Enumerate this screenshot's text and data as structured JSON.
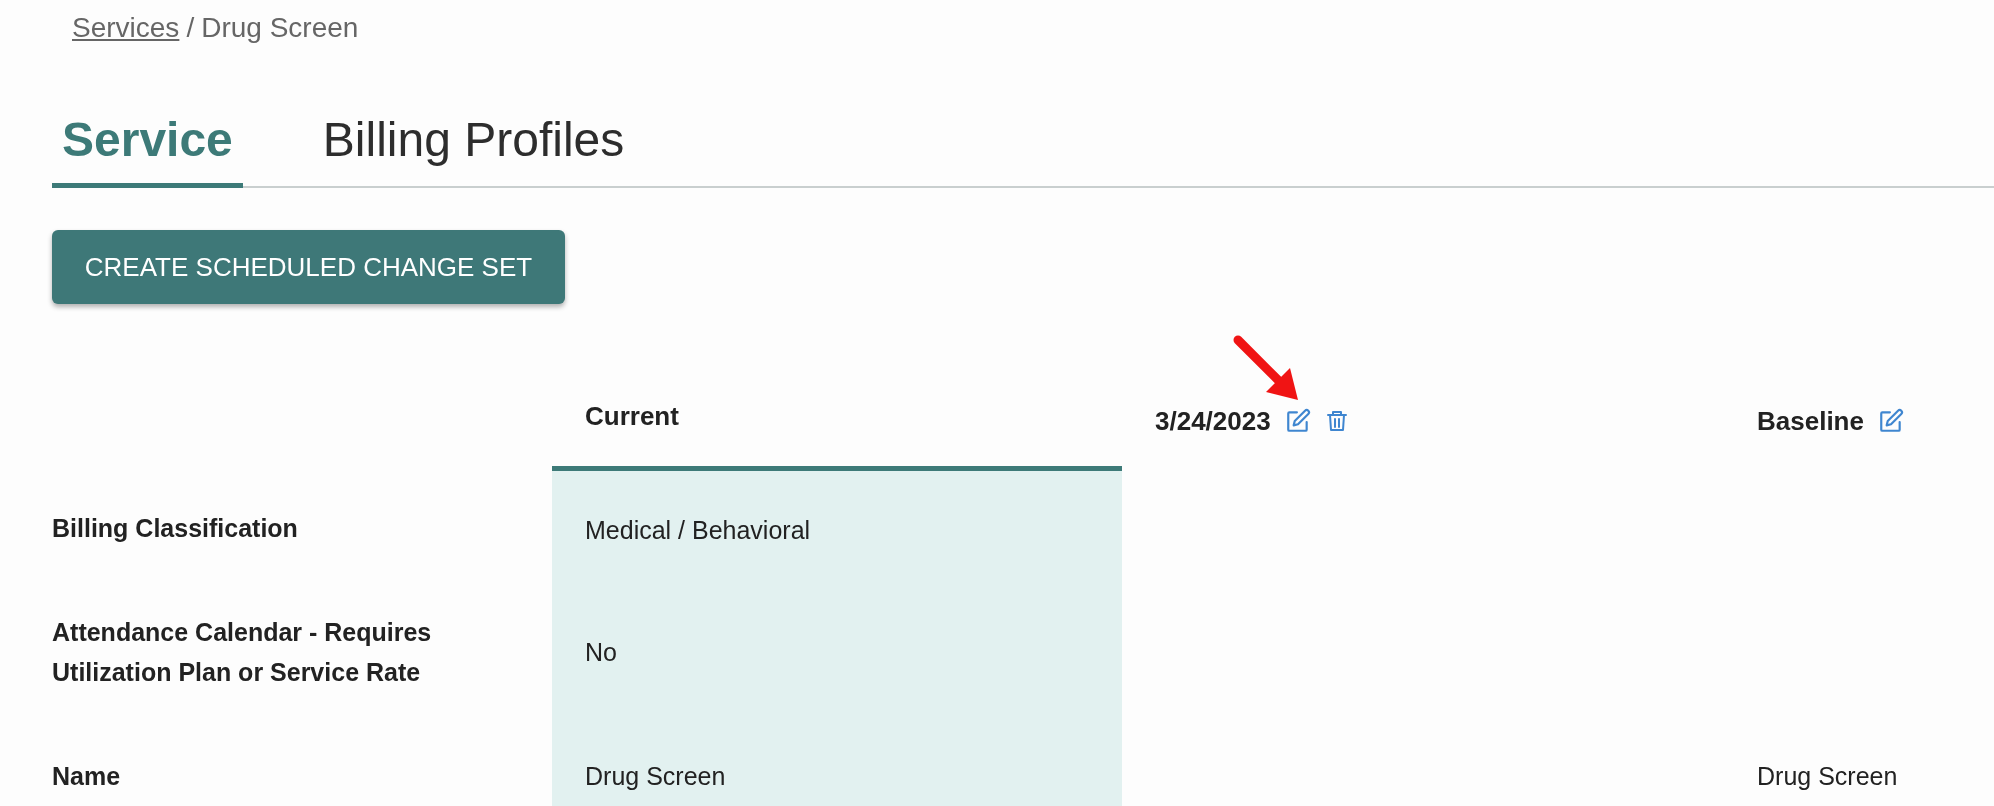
{
  "breadcrumb": {
    "link": "Services",
    "separator": "/",
    "current": "Drug Screen"
  },
  "tabs": [
    {
      "label": "Service",
      "selected": true
    },
    {
      "label": "Billing Profiles",
      "selected": false
    }
  ],
  "create_button": {
    "label": "CREATE SCHEDULED CHANGE SET"
  },
  "annotation": {
    "kind": "arrow"
  },
  "table": {
    "columns": [
      {
        "label": "Current",
        "kind": "current",
        "highlighted": true,
        "editable": false,
        "deletable": false
      },
      {
        "label": "3/24/2023",
        "kind": "scheduled",
        "highlighted": false,
        "editable": true,
        "deletable": true
      },
      {
        "label": "Baseline",
        "kind": "baseline",
        "highlighted": false,
        "editable": true,
        "deletable": false
      }
    ],
    "rows": [
      {
        "label": "Billing Classification",
        "current": "Medical / Behavioral"
      },
      {
        "label": "Attendance Calendar - Requires Utilization Plan or Service Rate",
        "current": "No"
      },
      {
        "label": "Name",
        "current": "Drug Screen",
        "baseline": "Drug Screen"
      }
    ]
  }
}
